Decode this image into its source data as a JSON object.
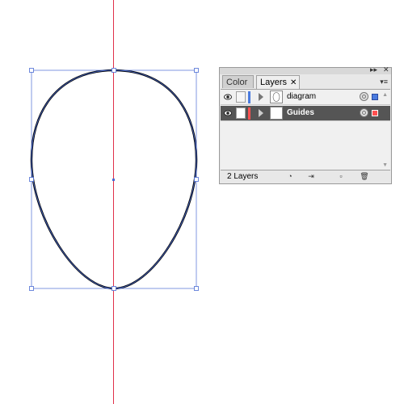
{
  "layers_panel": {
    "tabs": [
      {
        "label": "Color",
        "active": false
      },
      {
        "label": "Layers",
        "active": true
      }
    ],
    "titlebar_minimize": "▸▸",
    "titlebar_close": "✕",
    "tab_close": "✕",
    "menu_icon": "▾≡",
    "layers": [
      {
        "name": "diagram",
        "color": "#4a7bdf",
        "visible": true,
        "selected": false
      },
      {
        "name": "Guides",
        "color": "#ff5050",
        "visible": true,
        "selected": true
      }
    ],
    "footer": {
      "count_label": "2 Layers",
      "buttons": [
        "make-clipping-mask",
        "new-sublayer",
        "new-layer",
        "delete"
      ]
    }
  },
  "canvas": {
    "guide_color": "#e0304a",
    "selection_color": "#4a6cd4",
    "path_color": "#000000"
  }
}
